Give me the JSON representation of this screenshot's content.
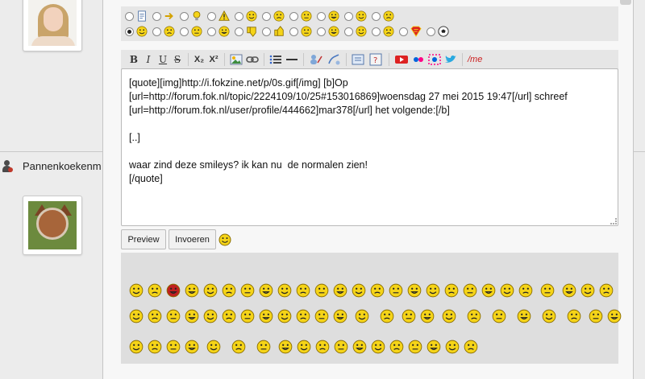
{
  "sidebar": {
    "user2_name": "Pannenkoekenm"
  },
  "mood_icons": {
    "row1": [
      "note-icon",
      "arrow-right-icon",
      "lightbulb-icon",
      "warning-icon",
      "confused-icon",
      "cool-icon",
      "smile-icon",
      "angry-icon",
      "frown-icon",
      "sunglasses-icon"
    ],
    "row2": [
      "smile-icon",
      "wink-icon",
      "shock-icon",
      "grin-icon",
      "thumbs-down-icon",
      "thumbs-up-icon",
      "neutral-icon",
      "sad-icon",
      "kiss-icon",
      "love-icon",
      "superman-icon",
      "soccer-ball-icon"
    ],
    "checked_index": 0
  },
  "toolbar": {
    "bold": "B",
    "italic": "I",
    "underline": "U",
    "strike": "S",
    "subscript": "X₂",
    "superscript": "X²",
    "me": "/me"
  },
  "editor": {
    "content": "[quote][img]http://i.fokzine.net/p/0s.gif[/img] [b]Op [url=http://forum.fok.nl/topic/2224109/10/25#153016869]woensdag 27 mei 2015 19:47[/url] schreef [url=http://forum.fok.nl/user/profile/444662]mar378[/url] het volgende:[/b]\n\n[..]\n\nwaar zind deze smileys? ik kan nu  de normalen zien!\n[/quote]"
  },
  "buttons": {
    "preview": "Preview",
    "submit": "Invoeren"
  },
  "colors": {
    "smiley_yellow": "#f5d418",
    "smiley_outline": "#8a6d00",
    "red": "#cc2222",
    "panel": "#dedede"
  }
}
